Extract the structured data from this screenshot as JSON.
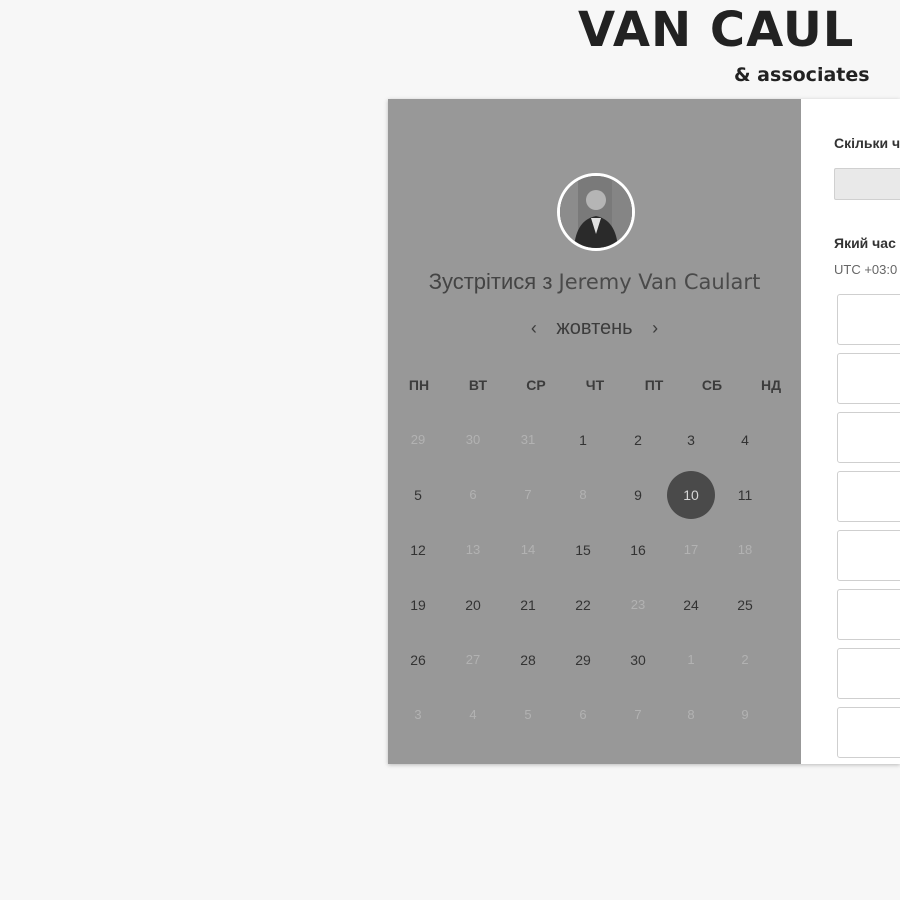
{
  "brand": {
    "name": "VAN CAUL",
    "sub": "& associates"
  },
  "calendar": {
    "title_prefix": "Зустрітися з",
    "host_name": "Jeremy Van Caulart",
    "month": "жовтень",
    "prev_symbol": "‹",
    "next_symbol": "›",
    "weekdays": [
      "ПН",
      "ВТ",
      "СР",
      "ЧТ",
      "ПТ",
      "СБ",
      "НД"
    ],
    "weeks": [
      [
        {
          "d": "29",
          "m": true
        },
        {
          "d": "30",
          "m": true
        },
        {
          "d": "31",
          "m": true
        },
        {
          "d": "1"
        },
        {
          "d": "2"
        },
        {
          "d": "3"
        },
        {
          "d": "4"
        }
      ],
      [
        {
          "d": "5"
        },
        {
          "d": "6",
          "m": true
        },
        {
          "d": "7",
          "m": true
        },
        {
          "d": "8",
          "m": true
        },
        {
          "d": "9"
        },
        {
          "d": "10",
          "sel": true
        },
        {
          "d": "11"
        }
      ],
      [
        {
          "d": "12"
        },
        {
          "d": "13",
          "m": true
        },
        {
          "d": "14",
          "m": true
        },
        {
          "d": "15"
        },
        {
          "d": "16"
        },
        {
          "d": "17",
          "m": true
        },
        {
          "d": "18",
          "m": true
        }
      ],
      [
        {
          "d": "19"
        },
        {
          "d": "20"
        },
        {
          "d": "21"
        },
        {
          "d": "22"
        },
        {
          "d": "23",
          "m": true
        },
        {
          "d": "24"
        },
        {
          "d": "25"
        }
      ],
      [
        {
          "d": "26"
        },
        {
          "d": "27",
          "m": true
        },
        {
          "d": "28"
        },
        {
          "d": "29"
        },
        {
          "d": "30"
        },
        {
          "d": "1",
          "m": true
        },
        {
          "d": "2",
          "m": true
        }
      ],
      [
        {
          "d": "3",
          "m": true
        },
        {
          "d": "4",
          "m": true
        },
        {
          "d": "5",
          "m": true
        },
        {
          "d": "6",
          "m": true
        },
        {
          "d": "7",
          "m": true
        },
        {
          "d": "8",
          "m": true
        },
        {
          "d": "9",
          "m": true
        }
      ]
    ]
  },
  "booking": {
    "duration_label": "Скільки ч",
    "time_label": "Який час",
    "timezone": "UTC +03:0"
  },
  "colors": {
    "overlay": "#989898",
    "selected_day": "#4a4a4a",
    "page_bg": "#f7f7f7"
  }
}
